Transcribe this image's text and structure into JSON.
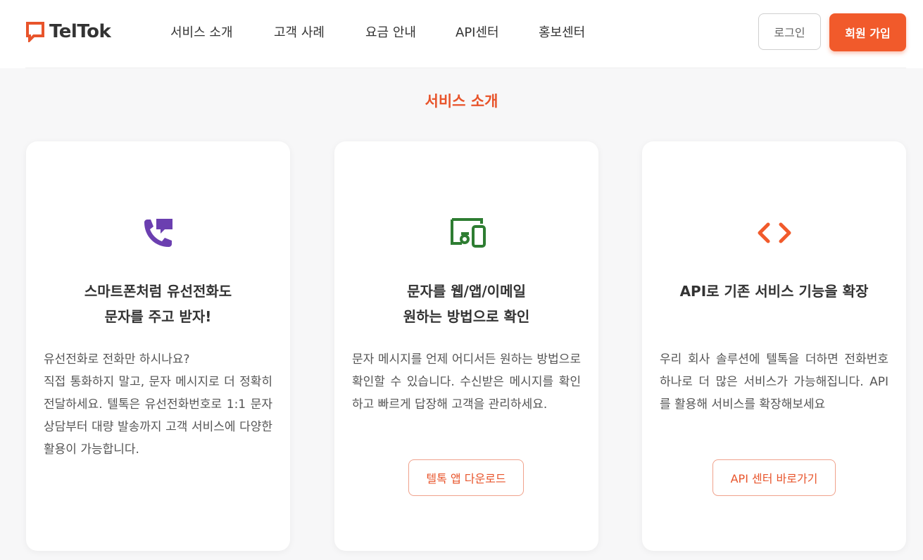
{
  "header": {
    "logo_text": "TelTok",
    "nav": [
      "서비스 소개",
      "고객 사례",
      "요금 안내",
      "API센터",
      "홍보센터"
    ],
    "login_label": "로그인",
    "signup_label": "회원 가입"
  },
  "section": {
    "title": "서비스 소개"
  },
  "cards": [
    {
      "icon": "phone-message-icon",
      "title_lines": [
        "스마트폰처럼 유선전화도",
        "문자를 주고 받자!"
      ],
      "description": "유선전화로 전화만 하시나요?\n직접 통화하지 말고, 문자 메시지로 더 정확히 전달하세요. 텔톡은 유선전화번호로 1:1 문자 상담부터 대량 발송까지 고객 서비스에 다양한 활용이 가능합니다."
    },
    {
      "icon": "devices-icon",
      "title_lines": [
        "문자를 웹/앱/이메일",
        "원하는 방법으로 확인"
      ],
      "description": "문자 메시지를 언제 어디서든 원하는 방법으로 확인할 수 있습니다. 수신받은 메시지를 확인하고 빠르게 답장해 고객을 관리하세요.",
      "button_label": "텔톡 앱 다운로드"
    },
    {
      "icon": "code-icon",
      "title_lines": [
        "API로 기존 서비스 기능을 확장"
      ],
      "description": "우리 회사 솔루션에 텔톡을 더하면 전화번호 하나로 더 많은 서비스가 가능해집니다. API를 활용해 서비스를 확장해보세요",
      "button_label": "API 센터 바로가기"
    }
  ],
  "colors": {
    "accent": "#f15a2b",
    "purple_icon": "#6b3fb0",
    "green_icon": "#2e7d32",
    "orange_icon": "#f15a2b"
  }
}
